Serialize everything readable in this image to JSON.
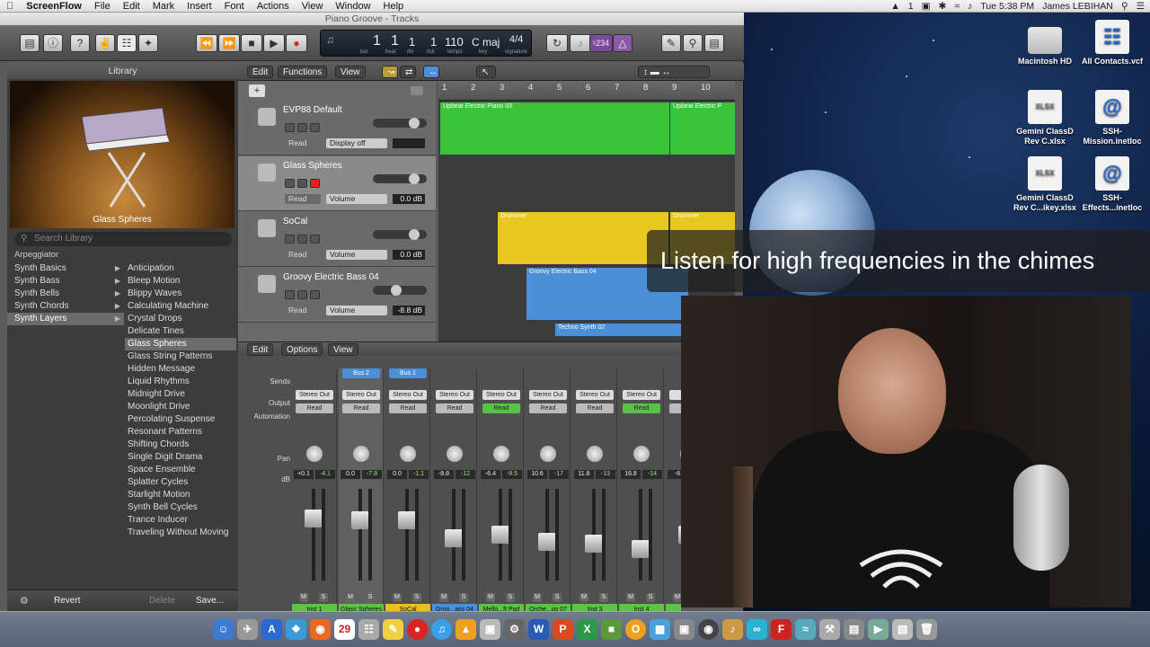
{
  "menubar": {
    "app": "ScreenFlow",
    "items": [
      "File",
      "Edit",
      "Mark",
      "Insert",
      "Font",
      "Actions",
      "View",
      "Window",
      "Help"
    ],
    "status": {
      "num": "1",
      "datetime": "Tue 5:38 PM",
      "user": "James LEBIHAN"
    }
  },
  "window": {
    "title": "Piano Groove - Tracks"
  },
  "lcd": {
    "bar": "1",
    "beat": "1",
    "div": "1",
    "tick": "1",
    "tempo": "110",
    "key": "C maj",
    "signature": "4/4",
    "labels": {
      "bar": "bar",
      "beat": "beat",
      "div": "div",
      "tick": "tick",
      "tempo": "tempo",
      "key": "key",
      "signature": "signature"
    },
    "count": "234"
  },
  "library": {
    "title": "Library",
    "preview_name": "Glass Spheres",
    "search_placeholder": "Search Library",
    "category": "Arpeggiator",
    "col1": [
      "Synth Basics",
      "Synth Bass",
      "Synth Bells",
      "Synth Chords",
      "Synth Layers"
    ],
    "col1_selected": 4,
    "col2": [
      "Anticipation",
      "Bleep Motion",
      "Blippy Waves",
      "Calculating Machine",
      "Crystal Drops",
      "Delicate Tines",
      "Glass Spheres",
      "Glass String Patterns",
      "Hidden Message",
      "Liquid Rhythms",
      "Midnight Drive",
      "Moonlight Drive",
      "Percolating Suspense",
      "Resonant Patterns",
      "Shifting Chords",
      "Single Digit Drama",
      "Space Ensemble",
      "Splatter Cycles",
      "Starlight Motion",
      "Synth Bell Cycles",
      "Trance Inducer",
      "Traveling Without Moving"
    ],
    "col2_selected": 6,
    "footer": {
      "revert": "Revert",
      "delete": "Delete",
      "save": "Save..."
    }
  },
  "tracks_menu": {
    "edit": "Edit",
    "functions": "Functions",
    "view": "View"
  },
  "ruler": [
    "1",
    "2",
    "3",
    "4",
    "5",
    "6",
    "7",
    "8",
    "9",
    "10"
  ],
  "tracks": [
    {
      "name": "EVP88 Default",
      "mode": "Read",
      "param": "Display off",
      "value": ""
    },
    {
      "name": "Glass Spheres",
      "mode": "Read",
      "param": "Volume",
      "value": "0.0 dB"
    },
    {
      "name": "SoCal",
      "mode": "Read",
      "param": "Volume",
      "value": "0.0 dB"
    },
    {
      "name": "Groovy Electric Bass 04",
      "mode": "Read",
      "param": "Volume",
      "value": "-8.8 dB"
    }
  ],
  "regions": {
    "piano1": "Upbeat Electric Piano 03",
    "piano2": "Upbeat Electric P",
    "drum1": "Drummer",
    "drum2": "Drummer",
    "bass": "Groovy Electric Bass 04",
    "techno": "Techno Synth 02"
  },
  "mixer_menu": {
    "edit": "Edit",
    "options": "Options",
    "view": "View"
  },
  "mixer_labels": {
    "sends": "Sends",
    "output": "Output",
    "automation": "Automation",
    "pan": "Pan",
    "db": "dB"
  },
  "mixer": [
    {
      "name": "Inst 1",
      "output": "Stereo Out",
      "auto": "Read",
      "vol": "+0.1",
      "peak": "-4.1",
      "color": "#5fc04a",
      "fader": 0.72
    },
    {
      "name": "Glass Spheres",
      "output": "Stereo Out",
      "auto": "Read",
      "vol": "0.0",
      "peak": "-7.8",
      "color": "#5fc04a",
      "send": "Bus 2",
      "fader": 0.7
    },
    {
      "name": "SoCal",
      "output": "Stereo Out",
      "auto": "Read",
      "vol": "0.0",
      "peak": "-1.1",
      "color": "#e8c020",
      "send": "Bus 1",
      "fader": 0.7
    },
    {
      "name": "Groo...ass 04",
      "output": "Stereo Out",
      "auto": "Read",
      "vol": "-8.8",
      "peak": "-12",
      "color": "#4a8fd8",
      "fader": 0.45
    },
    {
      "name": "Mello...ft Pad",
      "output": "Stereo Out",
      "auto": "Read",
      "vol": "-6.4",
      "peak": "-9.5",
      "color": "#5fc04a",
      "fader": 0.5
    },
    {
      "name": "Orche...gs 07",
      "output": "Stereo Out",
      "auto": "Read",
      "vol": "10.6",
      "peak": "-17",
      "color": "#5fc04a",
      "fader": 0.4
    },
    {
      "name": "Inst 3",
      "output": "Stereo Out",
      "auto": "Read",
      "vol": "11.8",
      "peak": "-13",
      "color": "#5fc04a",
      "fader": 0.38
    },
    {
      "name": "Inst 4",
      "output": "Stereo Out",
      "auto": "Read",
      "vol": "16.8",
      "peak": "-14",
      "color": "#5fc04a",
      "fader": 0.3
    },
    {
      "name": "Sim",
      "output": "St",
      "auto": "",
      "vol": "-6",
      "peak": "",
      "color": "#5fc04a",
      "fader": 0.5
    }
  ],
  "desktop": {
    "icons": [
      {
        "label": "Macintosh HD"
      },
      {
        "label": "All Contacts.vcf"
      },
      {
        "label": "Gemini ClassD Rev C.xlsx"
      },
      {
        "label": "SSH-Mission.inetloc"
      },
      {
        "label": "Gemini ClassD Rev C...ikey.xlsx"
      },
      {
        "label": "SSH-Effects...inetloc"
      }
    ]
  },
  "caption": "Listen for high frequencies in the chimes",
  "dock": {
    "calendar_day": "29"
  }
}
